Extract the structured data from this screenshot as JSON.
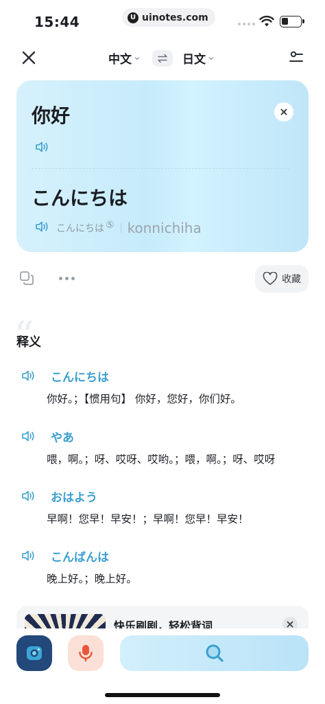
{
  "status_bar": {
    "time": "15:44",
    "url": "uinotes.com",
    "url_logo": "U",
    "battery_level": 0.35
  },
  "nav": {
    "source_lang": "中文",
    "target_lang": "日文",
    "icons": {
      "close": "close-icon",
      "swap": "swap-icon",
      "settings": "settings-icon"
    }
  },
  "card": {
    "source_text": "你好",
    "target_text": "こんにちは",
    "reading_kana": "こんにちは",
    "reading_tone": "⑤",
    "reading_romaji": "konnichiha"
  },
  "actions": {
    "favorite_label": "收藏"
  },
  "definitions": {
    "title": "释义",
    "items": [
      {
        "word": "こんにちは",
        "meaning": "你好。；【惯用句】 你好，您好，你们好。"
      },
      {
        "word": "やあ",
        "meaning": "喂，啊。；呀、哎呀、哎哟。；喂，啊。；呀、哎呀"
      },
      {
        "word": "おはよう",
        "meaning": "早啊！您早！早安！；早啊！您早！早安！"
      },
      {
        "word": "こんばんは",
        "meaning": "晚上好。；晚上好。"
      }
    ]
  },
  "promo": {
    "text": "快乐刷剧，轻松背词"
  },
  "colors": {
    "accent": "#3a9fcf",
    "camera_bg": "#23487a",
    "mic_bg": "#fbe0d8",
    "mic_icon": "#e9553a"
  }
}
